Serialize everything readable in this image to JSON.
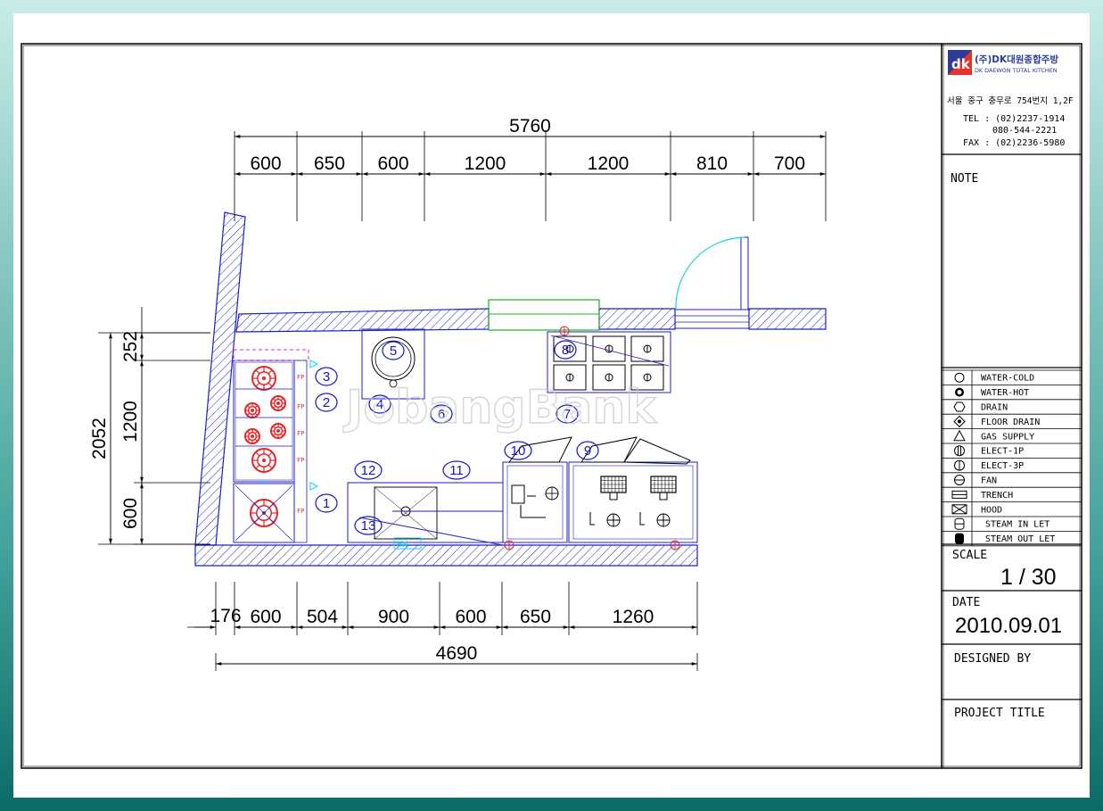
{
  "company": {
    "logo_mark": "dk",
    "name_ko": "(주)DK대원종합주방",
    "name_en": "DK DAEWON TOTAL KITCHEN",
    "address": "서울 중구 충무로 754번지 1,2F",
    "tel1": "TEL : (02)2237-1914",
    "tel2": "080-544-2221",
    "fax": "FAX : (02)2236-5980"
  },
  "labels": {
    "note": "NOTE",
    "scale_label": "SCALE",
    "scale_value": "1 / 30",
    "date_label": "DATE",
    "date_value": "2010.09.01",
    "designed_by": "DESIGNED BY",
    "project_title": "PROJECT TITLE"
  },
  "legend": [
    {
      "icon": "water-cold-icon",
      "label": "WATER-COLD"
    },
    {
      "icon": "water-hot-icon",
      "label": "WATER-HOT"
    },
    {
      "icon": "drain-icon",
      "label": "DRAIN"
    },
    {
      "icon": "floor-drain-icon",
      "label": "FLOOR DRAIN"
    },
    {
      "icon": "gas-supply-icon",
      "label": "GAS SUPPLY"
    },
    {
      "icon": "elect-1p-icon",
      "label": "ELECT-1P"
    },
    {
      "icon": "elect-3p-icon",
      "label": "ELECT-3P"
    },
    {
      "icon": "fan-icon",
      "label": "FAN"
    },
    {
      "icon": "trench-icon",
      "label": "TRENCH"
    },
    {
      "icon": "hood-icon",
      "label": "HOOD"
    },
    {
      "icon": "steam-inlet-icon",
      "label": "STEAM IN LET"
    },
    {
      "icon": "steam-outlet-icon",
      "label": "STEAM OUT LET"
    }
  ],
  "dimensions": {
    "top_total": "5760",
    "top": [
      "600",
      "650",
      "600",
      "1200",
      "1200",
      "810",
      "700"
    ],
    "bottom": [
      "176",
      "600",
      "504",
      "900",
      "600",
      "650",
      "1260"
    ],
    "bottom_total": "4690",
    "left_total": "2052",
    "left": [
      "252",
      "1200",
      "600"
    ]
  },
  "equipment_numbers": [
    "1",
    "2",
    "3",
    "4",
    "5",
    "6",
    "7",
    "8",
    "9",
    "10",
    "11",
    "12",
    "13"
  ],
  "watermark": "JobangBank"
}
